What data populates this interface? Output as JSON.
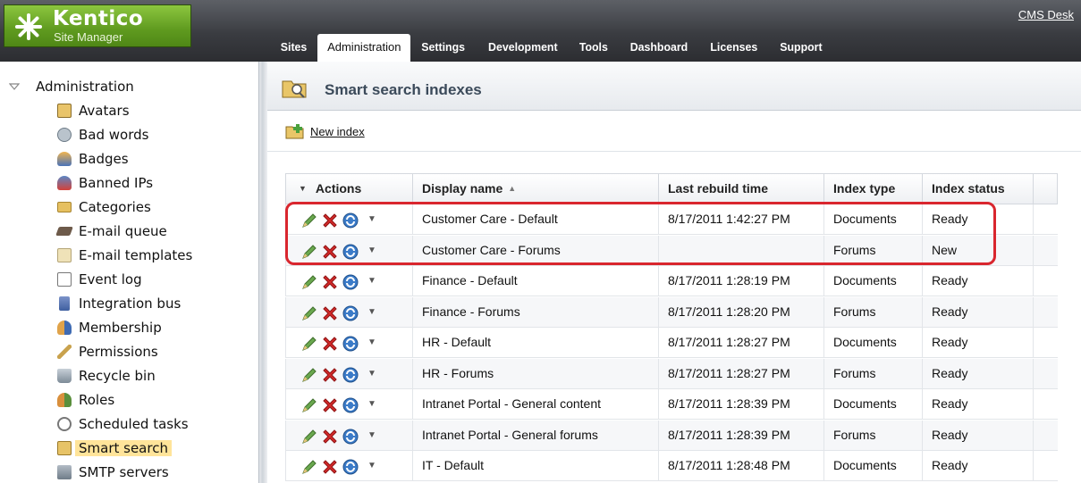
{
  "app": {
    "logo_title": "Kentico",
    "logo_subtitle": "Site Manager",
    "cms_desk_link": "CMS Desk"
  },
  "tabs": [
    {
      "label": "Sites"
    },
    {
      "label": "Administration"
    },
    {
      "label": "Settings"
    },
    {
      "label": "Development"
    },
    {
      "label": "Tools"
    },
    {
      "label": "Dashboard"
    },
    {
      "label": "Licenses"
    },
    {
      "label": "Support"
    }
  ],
  "active_tab": "Administration",
  "sidebar": {
    "root_label": "Administration",
    "items": [
      {
        "label": "Avatars",
        "icon": "avatar-icon"
      },
      {
        "label": "Bad words",
        "icon": "bad-words-icon"
      },
      {
        "label": "Badges",
        "icon": "badges-icon"
      },
      {
        "label": "Banned IPs",
        "icon": "banned-ips-icon"
      },
      {
        "label": "Categories",
        "icon": "categories-icon"
      },
      {
        "label": "E-mail queue",
        "icon": "email-queue-icon"
      },
      {
        "label": "E-mail templates",
        "icon": "email-templates-icon"
      },
      {
        "label": "Event log",
        "icon": "event-log-icon"
      },
      {
        "label": "Integration bus",
        "icon": "integration-bus-icon"
      },
      {
        "label": "Membership",
        "icon": "membership-icon"
      },
      {
        "label": "Permissions",
        "icon": "permissions-icon"
      },
      {
        "label": "Recycle bin",
        "icon": "recycle-bin-icon"
      },
      {
        "label": "Roles",
        "icon": "roles-icon"
      },
      {
        "label": "Scheduled tasks",
        "icon": "scheduled-tasks-icon"
      },
      {
        "label": "Smart search",
        "icon": "smart-search-icon"
      },
      {
        "label": "SMTP servers",
        "icon": "smtp-servers-icon"
      }
    ],
    "selected": "Smart search"
  },
  "main": {
    "title": "Smart search indexes",
    "new_index_label": "New index",
    "columns": [
      "Actions",
      "Display name",
      "Last rebuild time",
      "Index type",
      "Index status"
    ],
    "rows": [
      {
        "name": "Customer Care - Default",
        "time": "8/17/2011 1:42:27 PM",
        "type": "Documents",
        "status": "Ready"
      },
      {
        "name": "Customer Care - Forums",
        "time": "",
        "type": "Forums",
        "status": "New"
      },
      {
        "name": "Finance - Default",
        "time": "8/17/2011 1:28:19 PM",
        "type": "Documents",
        "status": "Ready"
      },
      {
        "name": "Finance - Forums",
        "time": "8/17/2011 1:28:20 PM",
        "type": "Forums",
        "status": "Ready"
      },
      {
        "name": "HR - Default",
        "time": "8/17/2011 1:28:27 PM",
        "type": "Documents",
        "status": "Ready"
      },
      {
        "name": "HR - Forums",
        "time": "8/17/2011 1:28:27 PM",
        "type": "Forums",
        "status": "Ready"
      },
      {
        "name": "Intranet Portal - General content",
        "time": "8/17/2011 1:28:39 PM",
        "type": "Documents",
        "status": "Ready"
      },
      {
        "name": "Intranet Portal - General forums",
        "time": "8/17/2011 1:28:39 PM",
        "type": "Forums",
        "status": "Ready"
      },
      {
        "name": "IT - Default",
        "time": "8/17/2011 1:28:48 PM",
        "type": "Documents",
        "status": "Ready"
      }
    ]
  },
  "colors": {
    "logo_green": "#6aa826",
    "header_dark": "#3a3c41",
    "highlight_red": "#d9262e",
    "selected_bg": "#ffe49a"
  }
}
